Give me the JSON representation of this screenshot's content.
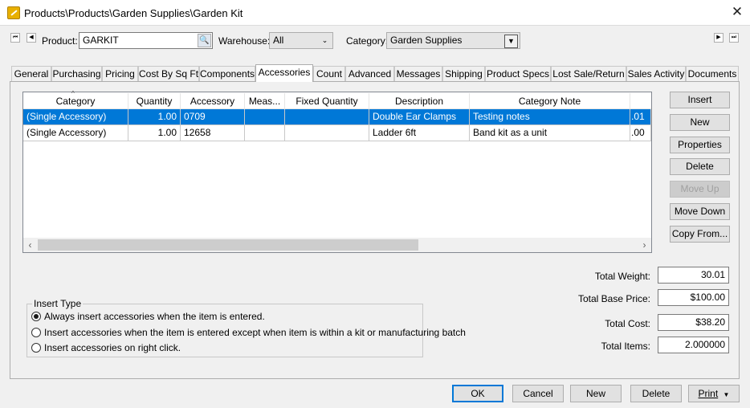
{
  "window": {
    "title": "Products\\Products\\Garden Supplies\\Garden Kit"
  },
  "header": {
    "product_label": "Product:",
    "product_value": "GARKIT",
    "warehouse_label": "Warehouse:",
    "warehouse_value": "All",
    "category_label": "Category:",
    "category_value": "Garden Supplies"
  },
  "tabs": [
    "General",
    "Purchasing",
    "Pricing",
    "Cost By Sq Ft",
    "Components",
    "Accessories",
    "Count",
    "Advanced",
    "Messages",
    "Shipping",
    "Product Specs",
    "Lost Sale/Return",
    "Sales Activity",
    "Documents"
  ],
  "active_tab": "Accessories",
  "grid": {
    "columns": [
      "Category",
      "Quantity",
      "Accessory",
      "Meas...",
      "Fixed Quantity",
      "Description",
      "Category Note"
    ],
    "rows": [
      {
        "category": "(Single Accessory)",
        "quantity": "1.00",
        "accessory": "0709",
        "meas": "",
        "fixed_quantity": "",
        "description": "Double Ear Clamps",
        "note": "Testing notes",
        "extra": ".01",
        "selected": true
      },
      {
        "category": "(Single Accessory)",
        "quantity": "1.00",
        "accessory": "12658",
        "meas": "",
        "fixed_quantity": "",
        "description": "Ladder 6ft",
        "note": "Band kit as a unit",
        "extra": ".00",
        "selected": false
      }
    ]
  },
  "side_buttons": {
    "insert": "Insert",
    "new": "New",
    "properties": "Properties",
    "delete": "Delete",
    "move_up": "Move Up",
    "move_down": "Move Down",
    "copy_from": "Copy From..."
  },
  "totals": {
    "weight_label": "Total Weight:",
    "weight_value": "30.01",
    "base_price_label": "Total Base Price:",
    "base_price_value": "$100.00",
    "cost_label": "Total Cost:",
    "cost_value": "$38.20",
    "items_label": "Total Items:",
    "items_value": "2.000000"
  },
  "insert_type": {
    "title": "Insert Type",
    "options": [
      "Always insert accessories when the item is entered.",
      "Insert accessories when the item is entered except when item is within a kit or manufacturing batch",
      "Insert accessories on right click."
    ],
    "selected_index": 0
  },
  "footer": {
    "ok": "OK",
    "cancel": "Cancel",
    "new": "New",
    "delete": "Delete",
    "print": "Print"
  },
  "colors": {
    "selection": "#0078d7",
    "accent": "#0078d7"
  }
}
